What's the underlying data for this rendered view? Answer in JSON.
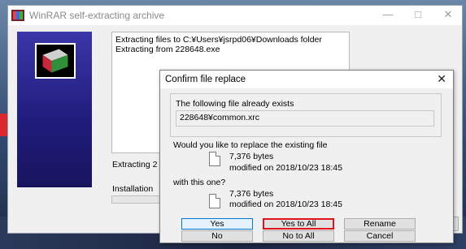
{
  "main_window": {
    "title": "WinRAR self-extracting archive",
    "log_line_1": "Extracting files to C:¥Users¥jsrpd06¥Downloads folder",
    "log_line_2": "Extracting from 228648.exe",
    "status_text": "Extracting 2",
    "install_text": "Installation",
    "minimize": "—",
    "maximize": "□",
    "close": "✕"
  },
  "dialog": {
    "title": "Confirm file replace",
    "close": "✕",
    "exists_label": "The following file already exists",
    "file_path": "228648¥common.xrc",
    "question": "Would you like to replace the existing file",
    "existing_size": "7,376 bytes",
    "existing_modified": "modified on 2018/10/23 18:45",
    "with_label": "with this one?",
    "new_size": "7,376 bytes",
    "new_modified": "modified on 2018/10/23 18:45",
    "buttons": {
      "yes": "Yes",
      "yes_to_all": "Yes to All",
      "rename": "Rename",
      "no": "No",
      "no_to_all": "No to All",
      "cancel": "Cancel"
    }
  },
  "colors": {
    "highlight": "#e0141e",
    "side_panel": "#2a2590"
  }
}
